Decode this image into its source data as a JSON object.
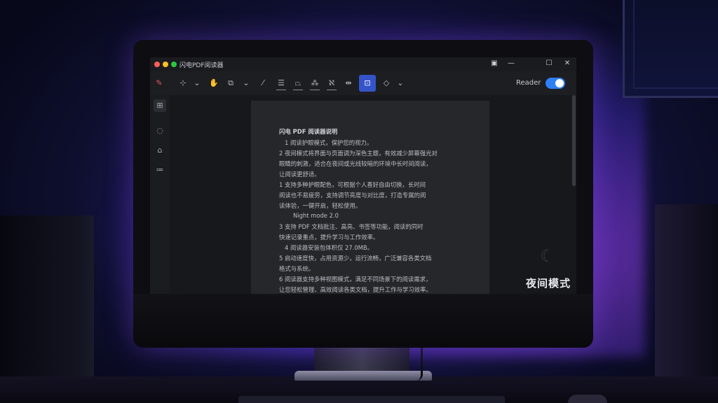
{
  "window": {
    "title": "闪电PDF阅读器",
    "controls": [
      "▣",
      "—",
      "☐",
      "✕"
    ]
  },
  "toolbar": {
    "tools": [
      {
        "name": "app-logo-icon",
        "glyph": "✎"
      },
      {
        "name": "select-icon",
        "glyph": "⊹"
      },
      {
        "name": "select-dropdown-icon",
        "glyph": "⌄"
      },
      {
        "name": "hand-icon",
        "glyph": "✋"
      },
      {
        "name": "edit-icon",
        "glyph": "⧉"
      },
      {
        "name": "edit-dropdown-icon",
        "glyph": "⌄"
      },
      {
        "name": "pen-icon",
        "glyph": "⁄"
      },
      {
        "name": "text-box-icon",
        "glyph": "☰"
      },
      {
        "name": "shape-icon",
        "glyph": "⏢"
      },
      {
        "name": "stamp-icon",
        "glyph": "⁂"
      },
      {
        "name": "sign-icon",
        "glyph": "ℵ"
      },
      {
        "name": "split-icon",
        "glyph": "⇹"
      },
      {
        "name": "annotate-icon",
        "glyph": "⊡"
      },
      {
        "name": "protect-icon",
        "glyph": "◇"
      },
      {
        "name": "protect-dropdown-icon",
        "glyph": "⌄"
      }
    ],
    "reader_label": "Reader",
    "reader_mode_on": true
  },
  "sidebar": {
    "items": [
      {
        "name": "thumbnails-icon",
        "glyph": "⊞"
      },
      {
        "name": "comments-icon",
        "glyph": "◌"
      },
      {
        "name": "bookmark-icon",
        "glyph": "⌂"
      },
      {
        "name": "outline-icon",
        "glyph": "≔"
      }
    ]
  },
  "document": {
    "lines": [
      "闪电 PDF 阅读器说明",
      "1 阅读护眼模式，保护您的视力。",
      "2 夜间模式将界面与页面调为深色主题，有效减少屏幕强光对",
      "眼睛的刺激，适合在夜间或光线较暗的环境中长时间阅读，",
      "让阅读更舒适。",
      "1 支持多种护眼配色，可根据个人喜好自由切换，长时间",
      "阅读也不易疲劳，支持调节亮度与对比度，打造专属的阅",
      "读体验，一键开启，轻松使用。",
      "Night mode 2.0",
      "3 支持 PDF 文档批注、高亮、书签等功能，阅读的同时",
      "快速记录重点，提升学习与工作效率。",
      "4 阅读器安装包体积仅 27.0MB。",
      "5 启动速度快，占用资源少，运行流畅，广泛兼容各类文档",
      "格式与系统。",
      "6 阅读器支持多种视图模式，满足不同场景下的阅读需求，",
      "让您轻松管理、高效阅读各类文档，提升工作与学习效率。"
    ]
  },
  "overlay": {
    "night_mode_label": "夜间模式",
    "moon_icon": "☾"
  },
  "colors": {
    "accent": "#3554c9",
    "toggle": "#2f7ff5",
    "close": "#ff5f57",
    "minimize": "#febc2e",
    "zoom": "#28c840"
  }
}
